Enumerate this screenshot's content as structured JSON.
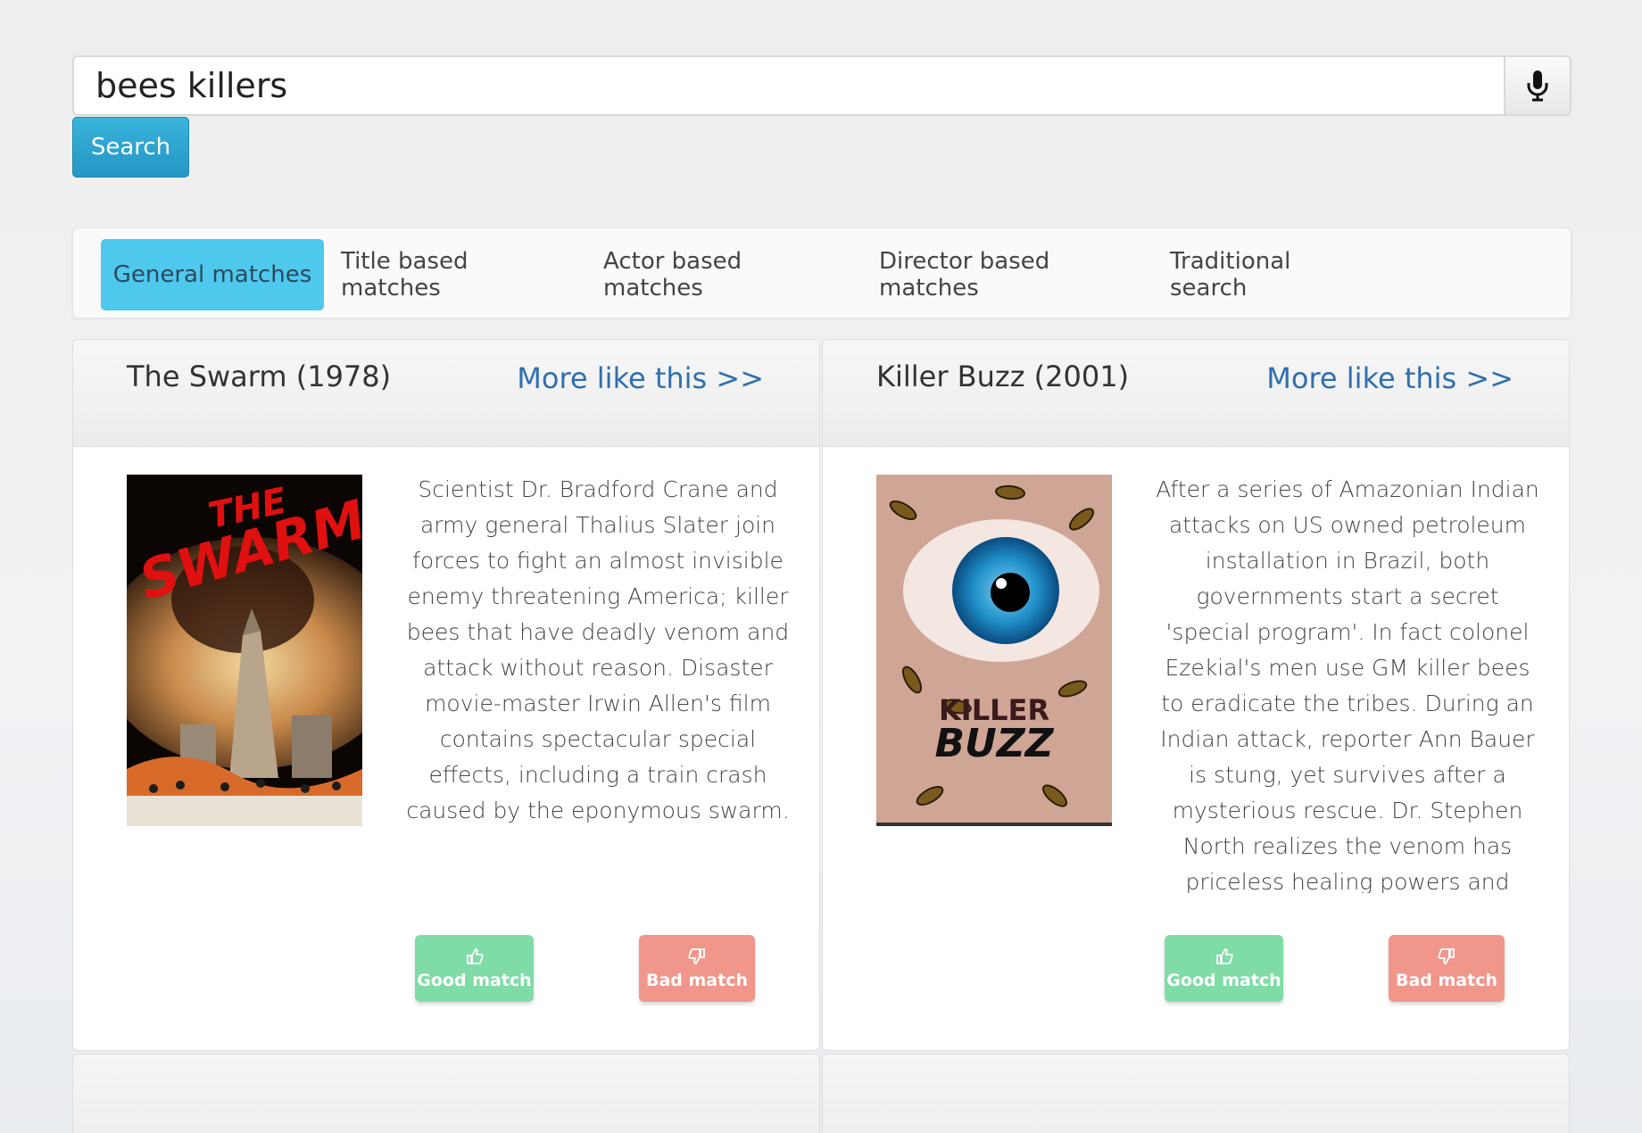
{
  "search": {
    "value": "bees killers",
    "button_label": "Search"
  },
  "tabs": [
    {
      "label": "General matches",
      "active": true
    },
    {
      "label": "Title based matches",
      "active": false
    },
    {
      "label": "Actor based matches",
      "active": false
    },
    {
      "label": "Director based matches",
      "active": false
    },
    {
      "label": "Traditional search",
      "active": false
    }
  ],
  "results": [
    {
      "title": "The Swarm (1978)",
      "more_link": "More like this >>",
      "poster_text": [
        "THE",
        "SWARM"
      ],
      "description": "Scientist Dr. Bradford Crane and army general Thalius Slater join forces to fight an almost invisible enemy threatening America; killer bees that have deadly venom and attack without reason. Disaster movie-master Irwin Allen's film contains spectacular special effects, including a train crash caused by the eponymous swarm.",
      "good_label": "Good match",
      "bad_label": "Bad match"
    },
    {
      "title": "Killer Buzz (2001)",
      "more_link": "More like this >>",
      "poster_text": [
        "KILLER",
        "BUZZ"
      ],
      "description": "After a series of Amazonian Indian attacks on US owned petroleum installation in Brazil, both governments start a secret 'special program'. In fact colonel Ezekial's men use GM killer bees to eradicate the tribes. During an Indian attack, reporter Ann Bauer is stung, yet survives after a mysterious rescue. Dr. Stephen North realizes the venom has priceless healing powers and smuggles the bee aboard a flight to",
      "good_label": "Good match",
      "bad_label": "Bad match"
    }
  ],
  "colors": {
    "primary_button": "#2ea6d2",
    "active_tab": "#4fc8ee",
    "link": "#2f6fae",
    "good_match": "#7fdca7",
    "bad_match": "#f0968b"
  },
  "icons": {
    "mic": "microphone-icon",
    "good": "thumbs-up-icon",
    "bad": "thumbs-down-icon"
  }
}
